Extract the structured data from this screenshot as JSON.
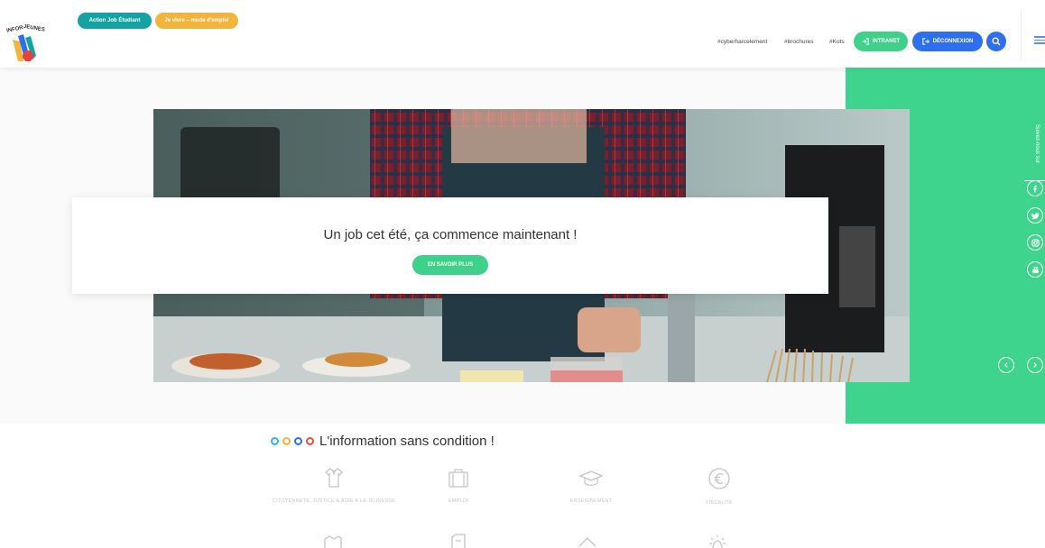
{
  "header": {
    "logo_text": "INFOR JEUNES",
    "pill_action": "Action Job Étudiant",
    "pill_vivre": "Je vivre – mode d'emploi",
    "hashtags": [
      "#cyberharcelement",
      "#brochures",
      "#Kots"
    ],
    "intranet_label": "INTRANET",
    "deconnexion_label": "DÉCONNEXION",
    "colors": {
      "teal": "#14a3a3",
      "yellow": "#f2b43a",
      "green": "#3fd08a",
      "blue": "#2d6ff0"
    }
  },
  "hero": {
    "title": "Un job cet été, ça commence maintenant !",
    "button": "EN SAVOIR PLUS",
    "follow_label": "Suivez-nous sur",
    "social_icons": [
      "facebook-icon",
      "twitter-icon",
      "instagram-icon",
      "youtube-icon"
    ]
  },
  "info": {
    "title": "L'information sans condition !",
    "categories": [
      {
        "label": "CITOYENNETÉ, JUSTICE & AIDE À LA JEUNESSE",
        "icon": "shirt-icon"
      },
      {
        "label": "EMPLOI",
        "icon": "briefcase-icon"
      },
      {
        "label": "ENSEIGNEMENT",
        "icon": "graduation-cap-icon"
      },
      {
        "label": "FISCALITÉ",
        "icon": "euro-icon"
      }
    ],
    "dot_colors": [
      "#2fb3e8",
      "#f2b43a",
      "#2d6ff0",
      "#e8503a"
    ]
  }
}
